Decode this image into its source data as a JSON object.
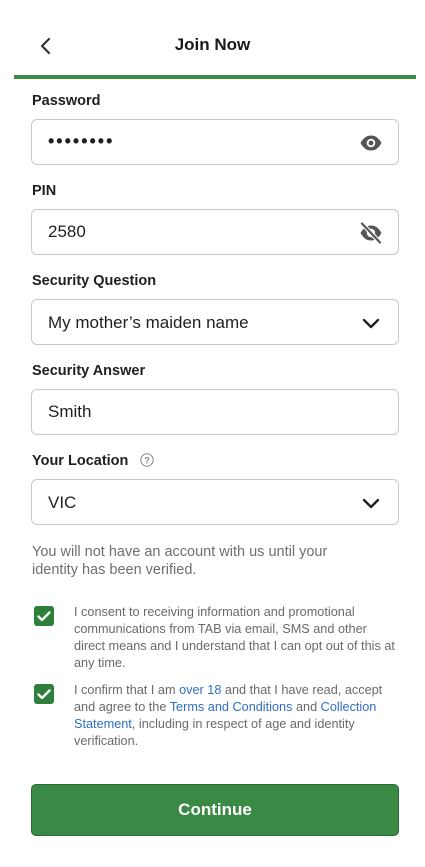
{
  "header": {
    "title": "Join Now",
    "progress": 1.0
  },
  "form": {
    "password": {
      "label": "Password",
      "masked_value": "••••••••"
    },
    "pin": {
      "label": "PIN",
      "value": "2580"
    },
    "security_question": {
      "label": "Security Question",
      "selected": "My mother’s maiden name"
    },
    "security_answer": {
      "label": "Security Answer",
      "value": "Smith"
    },
    "location": {
      "label": "Your Location",
      "selected": "VIC"
    }
  },
  "notice": "You will not have an account with us until your identity has been verified.",
  "consents": {
    "marketing": {
      "checked": true,
      "text": "I consent to receiving information and promotional communications from TAB via email, SMS and other direct means and I understand that I can opt out of this at any time."
    },
    "age": {
      "checked": true,
      "part1": "I confirm that I am ",
      "link1": "over 18",
      "part2": " and that I have read, accept and agree to the ",
      "link2": "Terms and Conditions",
      "part3": " and ",
      "link3": "Collection Statement",
      "part4": ", including in respect of age and identity verification."
    }
  },
  "buttons": {
    "continue": "Continue"
  },
  "icons": {
    "back": "chevron-left-icon",
    "show_password": "eye-icon",
    "hide_pin": "eye-off-icon",
    "dropdown": "chevron-down-icon",
    "help": "help-circle-icon",
    "check": "checkmark-icon"
  },
  "colors": {
    "accent": "#3a8a45",
    "link": "#2e6fc4",
    "muted_text": "#6f6f6f",
    "border": "#c9c9c9"
  }
}
